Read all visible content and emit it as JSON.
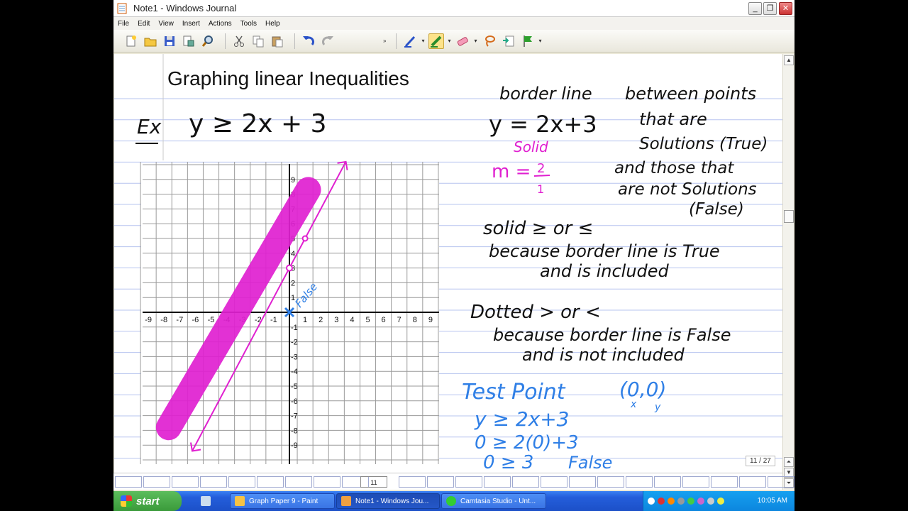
{
  "window": {
    "title": "Note1 - Windows Journal",
    "controls": {
      "minimize": "_",
      "restore": "❐",
      "close": "✕"
    }
  },
  "menu": [
    "File",
    "Edit",
    "View",
    "Insert",
    "Actions",
    "Tools",
    "Help"
  ],
  "toolbar": {
    "overflow": "»",
    "buttons": [
      "new-note-icon",
      "open-icon",
      "save-icon",
      "page-setup-icon",
      "find-icon",
      "cut-icon",
      "copy-icon",
      "paste-icon",
      "undo-icon",
      "redo-icon",
      "pen-icon",
      "highlighter-icon",
      "eraser-icon",
      "lasso-icon",
      "insert-space-icon",
      "flag-icon"
    ]
  },
  "note": {
    "title": "Graphing linear Inequalities",
    "example_label": "Ex",
    "equation": "y ≥ 2x + 3",
    "border_line_heading": "border line",
    "border_line_equation": "y = 2x+3",
    "solid_label": "Solid",
    "slope": {
      "prefix": "m =",
      "numerator": "2",
      "denominator": "1"
    },
    "explanation_lines": [
      "between points",
      "that are",
      "Solutions (True)",
      "and those that",
      "are not Solutions",
      "(False)"
    ],
    "solid_rule": "solid ≥ or ≤",
    "solid_reason_1": "because border line is True",
    "solid_reason_2": "and is included",
    "dotted_rule": "Dotted > or <",
    "dotted_reason_1": "because border line is False",
    "dotted_reason_2": "and is not included",
    "test_point_heading": "Test Point",
    "test_point_coords": "(0,0)",
    "test_point_sub_x": "x",
    "test_point_sub_y": "y",
    "test_lines": [
      "y ≥ 2x+3",
      "0 ≥ 2(0)+3",
      "0 ≥ 3"
    ],
    "test_result": "False",
    "graph_annotation": "False"
  },
  "graph": {
    "x_ticks": [
      "-9",
      "-8",
      "-7",
      "-6",
      "-5",
      "-4",
      "-3",
      "-2",
      "-1",
      "0",
      "1",
      "2",
      "3",
      "4",
      "5",
      "6",
      "7",
      "8",
      "9"
    ],
    "y_ticks": [
      "9",
      "8",
      "7",
      "6",
      "5",
      "4",
      "3",
      "2",
      "1",
      "-1",
      "-2",
      "-3",
      "-4",
      "-5",
      "-6",
      "-7",
      "-8",
      "-9"
    ],
    "line": {
      "slope": 2,
      "intercept": 3,
      "style": "solid"
    },
    "test_point": [
      0,
      0
    ],
    "colors": {
      "line": "#e020d0",
      "shade": "#e020d0",
      "test": "#2f7fe6"
    }
  },
  "page_indicator": "11 / 27",
  "page_strip": {
    "current": "11"
  },
  "taskbar": {
    "start": "start",
    "tasks": [
      "Graph Paper 9 - Paint",
      "Note1 - Windows Jou...",
      "Camtasia Studio - Unt..."
    ],
    "clock": "10:05 AM"
  }
}
